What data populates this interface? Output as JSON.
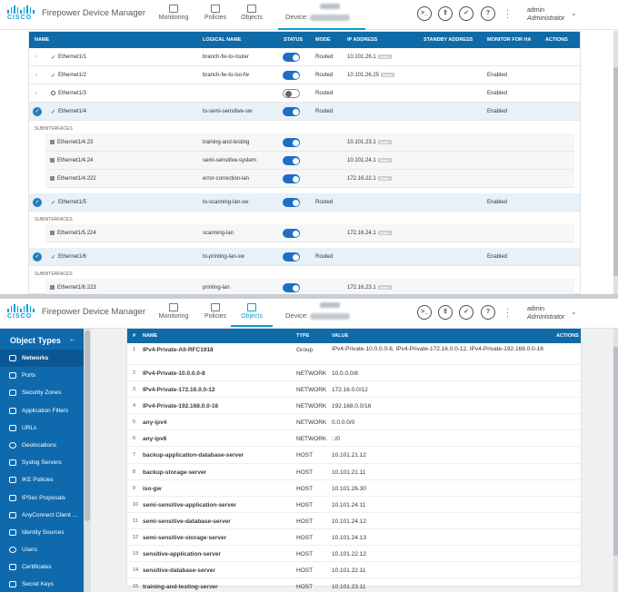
{
  "app": {
    "logo_text": "CISCO",
    "name": "Firepower Device Manager"
  },
  "top_header": {
    "tabs": [
      {
        "label": "Monitoring",
        "icon": "monitor-icon"
      },
      {
        "label": "Policies",
        "icon": "policies-icon"
      },
      {
        "label": "Objects",
        "icon": "objects-icon"
      }
    ],
    "active_tab": "Device",
    "device_label": "Device:",
    "user": {
      "name": "admin",
      "role": "Administrator"
    }
  },
  "bottom_header": {
    "tabs": [
      {
        "label": "Monitoring"
      },
      {
        "label": "Policies"
      },
      {
        "label": "Objects"
      }
    ],
    "active_tab": "Objects",
    "device_label": "Device:",
    "user": {
      "name": "admin",
      "role": "Administrator"
    }
  },
  "interfaces": {
    "columns": [
      "NAME",
      "LOGICAL NAME",
      "STATUS",
      "MODE",
      "IP ADDRESS",
      "STANDBY ADDRESS",
      "MONITOR FOR HA",
      "ACTIONS"
    ],
    "ip_badge": "Static",
    "subinterfaces_label": "SUBINTERFACES",
    "rows": [
      {
        "name": "Ethernet1/1",
        "logical": "branch-fw-to-router",
        "enabled": true,
        "mode": "Routed",
        "ip": "10.101.26.1",
        "monitor": ""
      },
      {
        "name": "Ethernet1/2",
        "logical": "branch-fw-to-iso-fw",
        "enabled": true,
        "mode": "Routed",
        "ip": "10.101.26.25",
        "monitor": "Enabled"
      },
      {
        "name": "Ethernet1/3",
        "logical": "",
        "enabled": false,
        "mode": "Routed",
        "ip": "",
        "monitor": "Enabled"
      },
      {
        "name": "Ethernet1/4",
        "logical": "to-semi-sensitive-sw",
        "enabled": true,
        "mode": "Routed",
        "ip": "",
        "monitor": "Enabled"
      },
      {
        "name": "Ethernet1/5",
        "logical": "to-scanning-lan-sw",
        "enabled": true,
        "mode": "Routed",
        "ip": "",
        "monitor": "Enabled"
      },
      {
        "name": "Ethernet1/6",
        "logical": "to-printing-lan-sw",
        "enabled": true,
        "mode": "Routed",
        "ip": "",
        "monitor": "Enabled"
      }
    ],
    "sub_e14": [
      {
        "name": "Ethernet1/4.23",
        "logical": "training-and-testing",
        "ip": "10.101.23.1"
      },
      {
        "name": "Ethernet1/4.24",
        "logical": "semi-sensitive-system",
        "ip": "10.101.24.1"
      },
      {
        "name": "Ethernet1/4.222",
        "logical": "error-correction-lan",
        "ip": "172.16.22.1"
      }
    ],
    "sub_e15": [
      {
        "name": "Ethernet1/5.224",
        "logical": "scanning-lan",
        "ip": "172.16.24.1"
      }
    ],
    "sub_e16": [
      {
        "name": "Ethernet1/6.223",
        "logical": "printing-lan",
        "ip": "172.16.23.1"
      }
    ]
  },
  "sidebar": {
    "title": "Object Types",
    "back_icon": "arrow-left-icon",
    "items": [
      "Networks",
      "Ports",
      "Security Zones",
      "Application Filters",
      "URLs",
      "Geolocations",
      "Syslog Servers",
      "IKE Policies",
      "IPSec Proposals",
      "AnyConnect Client ...",
      "Identity Sources",
      "Users",
      "Certificates",
      "Secret Keys"
    ],
    "active": "Networks"
  },
  "objects": {
    "columns": [
      "#",
      "NAME",
      "TYPE",
      "VALUE",
      "ACTIONS"
    ],
    "rows": [
      {
        "n": "1",
        "name": "IPv4-Private-All-RFC1918",
        "type": "Group",
        "value": "IPv4-Private-10.0.0.0-8, IPv4-Private-172.16.0.0-12, IPv4-Private-192.168.0.0-16"
      },
      {
        "n": "2",
        "name": "IPv4-Private-10.0.0.0-8",
        "type": "NETWORK",
        "value": "10.0.0.0/8"
      },
      {
        "n": "3",
        "name": "IPv4-Private-172.16.0.0-12",
        "type": "NETWORK",
        "value": "172.16.0.0/12"
      },
      {
        "n": "4",
        "name": "IPv4-Private-192.168.0.0-16",
        "type": "NETWORK",
        "value": "192.168.0.0/16"
      },
      {
        "n": "5",
        "name": "any-ipv4",
        "type": "NETWORK",
        "value": "0.0.0.0/0"
      },
      {
        "n": "6",
        "name": "any-ipv6",
        "type": "NETWORK",
        "value": "::/0"
      },
      {
        "n": "7",
        "name": "backup-application-database-server",
        "type": "HOST",
        "value": "10.101.21.12"
      },
      {
        "n": "8",
        "name": "backup-storage-server",
        "type": "HOST",
        "value": "10.101.21.11"
      },
      {
        "n": "9",
        "name": "iso-gw",
        "type": "HOST",
        "value": "10.101.26.30"
      },
      {
        "n": "10",
        "name": "semi-sensitive-application-server",
        "type": "HOST",
        "value": "10.101.24.11"
      },
      {
        "n": "11",
        "name": "semi-sensitive-database-server",
        "type": "HOST",
        "value": "10.101.24.12"
      },
      {
        "n": "12",
        "name": "semi-sensitive-storage-server",
        "type": "HOST",
        "value": "10.101.24.13"
      },
      {
        "n": "13",
        "name": "sensitive-application-server",
        "type": "HOST",
        "value": "10.101.22.12"
      },
      {
        "n": "14",
        "name": "sensitive-database-server",
        "type": "HOST",
        "value": "10.101.22.11"
      },
      {
        "n": "15",
        "name": "training-and-testing-server",
        "type": "HOST",
        "value": "10.101.23.11"
      }
    ]
  },
  "colors": {
    "brand": "#049fd9",
    "header_bar": "#0f6aa8",
    "sidebar": "#0e6aad",
    "toggle_on": "#1e6fc4",
    "ok": "#2e8b3d"
  }
}
